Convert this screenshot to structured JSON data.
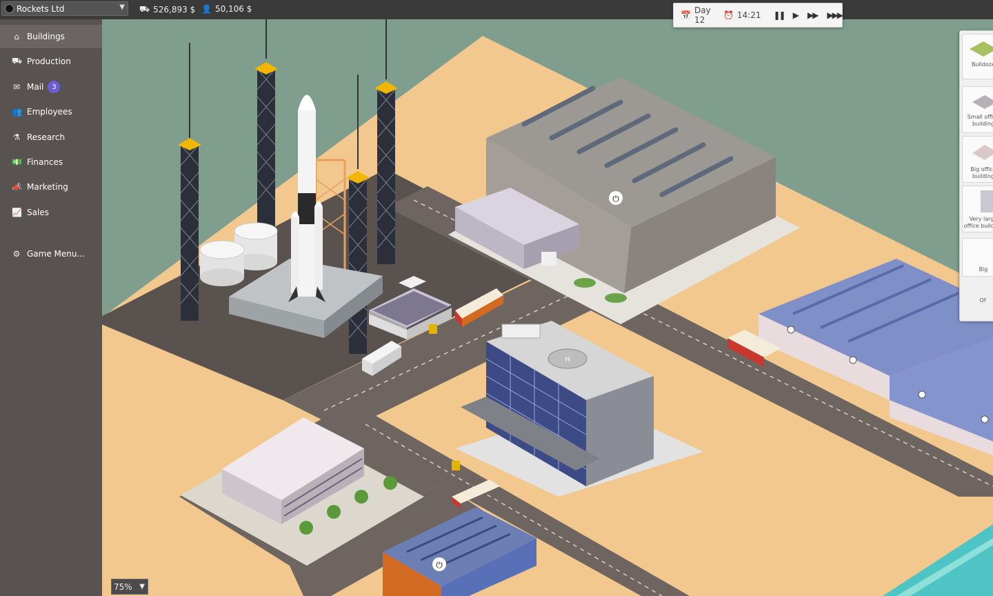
{
  "company": {
    "name": "Rockets Ltd"
  },
  "stats": {
    "money": "526,893 $",
    "employees": "50,106 $"
  },
  "clock": {
    "day": "Day 12",
    "time": "14:21"
  },
  "menu": [
    {
      "label": "Buildings",
      "icon": "home-icon",
      "glyph": "⌂"
    },
    {
      "label": "Production",
      "icon": "forklift-icon",
      "glyph": "⛟"
    },
    {
      "label": "Mail",
      "icon": "envelope-icon",
      "glyph": "✉",
      "badge": "3"
    },
    {
      "label": "Employees",
      "icon": "people-icon",
      "glyph": "👥"
    },
    {
      "label": "Research",
      "icon": "flask-icon",
      "glyph": "⚗"
    },
    {
      "label": "Finances",
      "icon": "money-icon",
      "glyph": "💵"
    },
    {
      "label": "Marketing",
      "icon": "megaphone-icon",
      "glyph": "📣"
    },
    {
      "label": "Sales",
      "icon": "chart-icon",
      "glyph": "📈"
    },
    {
      "label": "Game Menu...",
      "icon": "gear-icon",
      "glyph": "⚙"
    }
  ],
  "build_panel": [
    {
      "label": "Bulldoze"
    },
    {
      "label": "Small office building"
    },
    {
      "label": "Big office building"
    },
    {
      "label": "Very large office building"
    },
    {
      "label": "Big"
    },
    {
      "label": "Of"
    }
  ],
  "zoom": {
    "level": "75%"
  },
  "colors": {
    "sand": "#f2c88f",
    "road": "#6e6560",
    "sea": "#7f9e8e",
    "sidebar": "#585350"
  }
}
